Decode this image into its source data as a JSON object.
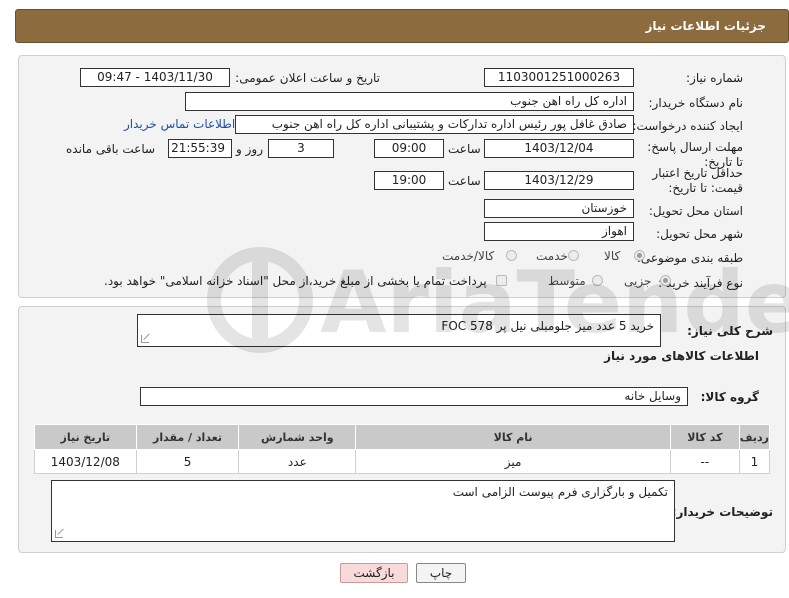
{
  "header": {
    "title": "جزئیات اطلاعات نیاز"
  },
  "form": {
    "need_number": {
      "label": "شماره نیاز:",
      "value": "1103001251000263"
    },
    "announce": {
      "label": "تاریخ و ساعت اعلان عمومی:",
      "value": "1403/11/30 - 09:47"
    },
    "buyer_org": {
      "label": "نام دستگاه خریدار:",
      "value": "اداره کل راه اهن جنوب"
    },
    "creator": {
      "label": "ایجاد کننده درخواست:",
      "value": "صادق غافل پور رئیس اداره تدارکات و پشتیبانی اداره کل راه اهن جنوب",
      "contact_link": "اطلاعات تماس خریدار"
    },
    "deadline": {
      "label": "مهلت ارسال پاسخ: تا تاریخ:",
      "date": "1403/12/04",
      "time_label": "ساعت",
      "time": "09:00",
      "days": "3",
      "days_label": "روز و",
      "remaining": "21:55:39",
      "remaining_label": "ساعت باقی مانده"
    },
    "validity": {
      "label": "حداقل تاریخ اعتبار قیمت: تا تاریخ:",
      "date": "1403/12/29",
      "time_label": "ساعت",
      "time": "19:00"
    },
    "province": {
      "label": "استان محل تحویل:",
      "value": "خوزستان"
    },
    "city": {
      "label": "شهر محل تحویل:",
      "value": "اهواز"
    },
    "category": {
      "label": "طبقه بندی موضوعی:",
      "options": [
        "کالا",
        "خدمت",
        "کالا/خدمت"
      ],
      "selected": "کالا"
    },
    "process": {
      "label": "نوع فرآیند خرید :",
      "options": [
        "جزیی",
        "متوسط"
      ],
      "selected": "جزیی",
      "payment_note": "پرداخت تمام یا بخشی از مبلغ خرید،از محل \"اسناد خزانه اسلامی\" خواهد بود."
    }
  },
  "summary": {
    "label": "شرح کلی نیاز:",
    "value": "خرید 5 عدد میز جلومبلی نیل پر      FOC 578"
  },
  "goods_title": "اطلاعات کالاهای مورد نیاز",
  "goods_group": {
    "label": "گروه کالا:",
    "value": "وسایل خانه"
  },
  "table": {
    "headers": [
      "ردیف",
      "کد کالا",
      "نام کالا",
      "واحد شمارش",
      "تعداد / مقدار",
      "تاریخ نیاز"
    ],
    "rows": [
      [
        "1",
        "--",
        "میز",
        "عدد",
        "5",
        "1403/12/08"
      ]
    ]
  },
  "buyer_notes": {
    "label": "توضیحات خریدار:",
    "value": "تکمیل و بارگزاری فرم پیوست الزامی است"
  },
  "buttons": {
    "print": "چاپ",
    "back": "بازگشت"
  },
  "watermark": {
    "text": "AriaTender.neT"
  }
}
